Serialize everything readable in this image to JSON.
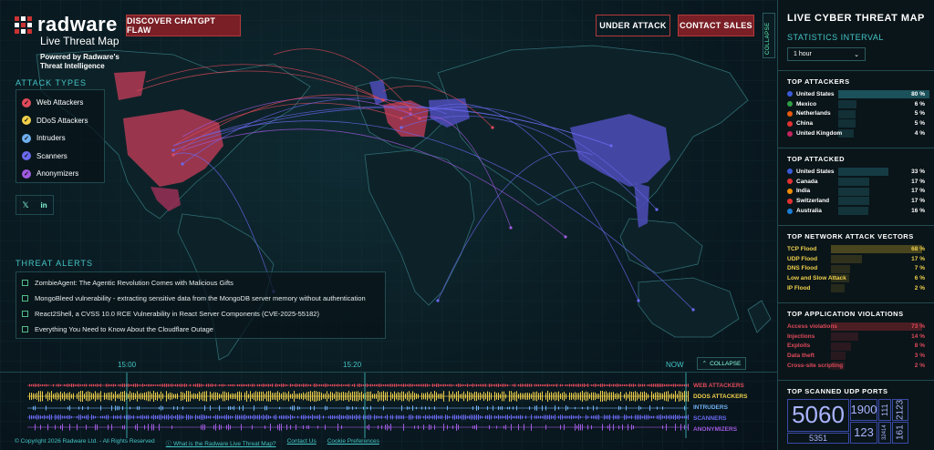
{
  "brand": {
    "name": "radware",
    "subtitle": "Live Threat Map",
    "powered": "Powered by Radware's Threat Intelligence"
  },
  "header": {
    "chatgpt_button": "DISCOVER CHATGPT FLAW",
    "under_attack_button": "UNDER ATTACK",
    "contact_button": "CONTACT SALES",
    "collapse_tab": "COLLAPSE"
  },
  "attack_types": {
    "title": "ATTACK TYPES",
    "items": [
      {
        "label": "Web Attackers",
        "color": "#e04a5a"
      },
      {
        "label": "DDoS Attackers",
        "color": "#f0d04a"
      },
      {
        "label": "Intruders",
        "color": "#6fb0f0"
      },
      {
        "label": "Scanners",
        "color": "#6a6af0"
      },
      {
        "label": "Anonymizers",
        "color": "#a05ae0"
      }
    ]
  },
  "social": {
    "x_icon": "𝕏",
    "linkedin_icon": "in"
  },
  "threat_alerts": {
    "title": "THREAT ALERTS",
    "items": [
      "ZombieAgent: The Agentic Revolution Comes with Malicious Gifts",
      "MongoBleed vulnerability - extracting sensitive data from the MongoDB server memory without authentication",
      "React2Shell, a CVSS 10.0 RCE Vulnerability in React Server Components (CVE-2025-55182)",
      "Everything You Need to Know About the Cloudflare Outage"
    ]
  },
  "timeline": {
    "time_labels": [
      "15:00",
      "15:20",
      "NOW"
    ],
    "collapse": "COLLAPSE",
    "legend": [
      {
        "label": "WEB ATTACKERS",
        "color": "#e04a5a"
      },
      {
        "label": "DDOS ATTACKERS",
        "color": "#f0d04a"
      },
      {
        "label": "INTRUDERS",
        "color": "#6fb0f0"
      },
      {
        "label": "SCANNERS",
        "color": "#6a6af0"
      },
      {
        "label": "ANONYMIZERS",
        "color": "#a05ae0"
      }
    ]
  },
  "footer": {
    "copyright": "© Copyright 2026 Radware Ltd. - All Rights Reserved",
    "about": "ⓘ What is the Radware Live Threat Map?",
    "contact": "Contact Us",
    "cookies": "Cookie Preferences"
  },
  "sidebar": {
    "title": "LIVE CYBER THREAT MAP",
    "interval_label": "STATISTICS INTERVAL",
    "interval_value": "1 hour",
    "top_attackers": {
      "title": "TOP ATTACKERS",
      "rows": [
        {
          "name": "United States",
          "value": "80 %",
          "pct": 80,
          "flag": "#3b5bdb"
        },
        {
          "name": "Mexico",
          "value": "6 %",
          "pct": 6,
          "flag": "#2f9e44"
        },
        {
          "name": "Netherlands",
          "value": "5 %",
          "pct": 5,
          "flag": "#e8590c"
        },
        {
          "name": "China",
          "value": "5 %",
          "pct": 5,
          "flag": "#e03131"
        },
        {
          "name": "United Kingdom",
          "value": "4 %",
          "pct": 4,
          "flag": "#c2255c"
        }
      ]
    },
    "top_attacked": {
      "title": "TOP ATTACKED",
      "rows": [
        {
          "name": "United States",
          "value": "33 %",
          "pct": 33,
          "flag": "#3b5bdb"
        },
        {
          "name": "Canada",
          "value": "17 %",
          "pct": 17,
          "flag": "#e03131"
        },
        {
          "name": "India",
          "value": "17 %",
          "pct": 17,
          "flag": "#f08c00"
        },
        {
          "name": "Switzerland",
          "value": "17 %",
          "pct": 17,
          "flag": "#e03131"
        },
        {
          "name": "Australia",
          "value": "16 %",
          "pct": 16,
          "flag": "#1c7ed6"
        }
      ]
    },
    "top_vectors": {
      "title": "TOP NETWORK ATTACK VECTORS",
      "rows": [
        {
          "name": "TCP Flood",
          "value": "68 %",
          "pct": 68
        },
        {
          "name": "UDP Flood",
          "value": "17 %",
          "pct": 17
        },
        {
          "name": "DNS Flood",
          "value": "7 %",
          "pct": 7
        },
        {
          "name": "Low and Slow Attack",
          "value": "6 %",
          "pct": 6
        },
        {
          "name": "IP Flood",
          "value": "2 %",
          "pct": 2
        }
      ]
    },
    "top_violations": {
      "title": "TOP APPLICATION VIOLATIONS",
      "rows": [
        {
          "name": "Access violations",
          "value": "73 %",
          "pct": 73
        },
        {
          "name": "Injections",
          "value": "14 %",
          "pct": 14
        },
        {
          "name": "Exploits",
          "value": "8 %",
          "pct": 8
        },
        {
          "name": "Data theft",
          "value": "3 %",
          "pct": 3
        },
        {
          "name": "Cross-site scripting",
          "value": "2 %",
          "pct": 2
        }
      ]
    },
    "top_ports": {
      "title": "TOP SCANNED UDP PORTS",
      "ports": [
        "5060",
        "1900",
        "111",
        "2123",
        "123",
        "32414",
        "161",
        "5351"
      ]
    }
  }
}
